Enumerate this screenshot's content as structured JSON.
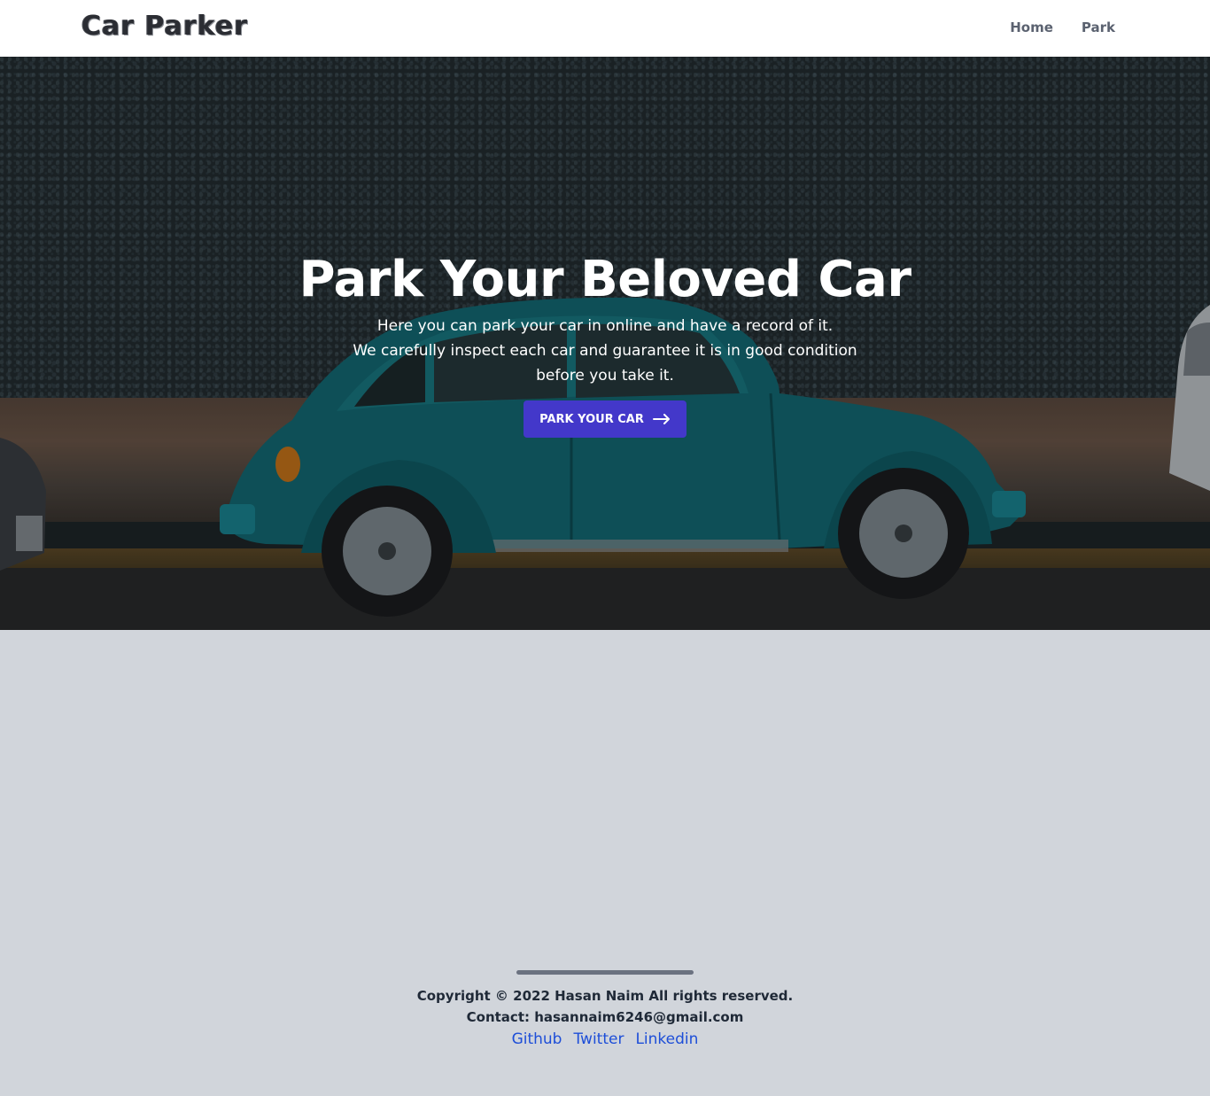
{
  "header": {
    "logo": "Car Parker",
    "nav": [
      {
        "label": "Home"
      },
      {
        "label": "Park"
      }
    ]
  },
  "hero": {
    "title": "Park Your Beloved Car",
    "line1": "Here you can park your car in online and have a record of it.",
    "line2": "We carefully inspect each car and guarantee it is in good condition before you take it.",
    "button_label": "PARK YOUR CAR",
    "button_icon": "arrow-right-icon",
    "button_color": "#4338ca"
  },
  "footer": {
    "copyright": "Copyright © 2022 Hasan Naim All rights reserved.",
    "contact": "Contact: hasannaim6246@gmail.com",
    "links": [
      {
        "label": "Github"
      },
      {
        "label": "Twitter"
      },
      {
        "label": "Linkedin"
      }
    ],
    "link_color": "#1d4ed8",
    "background": "#d1d5db"
  }
}
